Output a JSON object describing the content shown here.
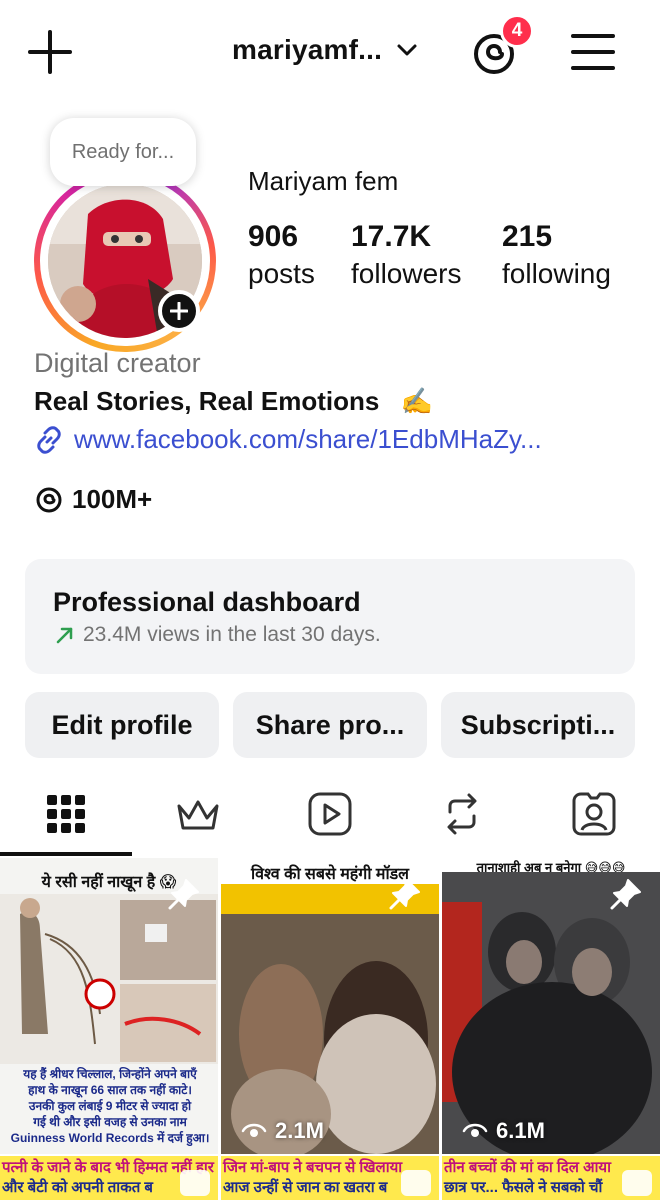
{
  "header": {
    "username": "mariyamf...",
    "notification_count": "4"
  },
  "note": {
    "text": "Ready for..."
  },
  "profile": {
    "display_name": "Mariyam fem",
    "stats": [
      {
        "value": "906",
        "label": "posts"
      },
      {
        "value": "17.7K",
        "label": "followers"
      },
      {
        "value": "215",
        "label": "following"
      }
    ],
    "category": "Digital creator",
    "bio": "Real Stories, Real Emotions",
    "bio_emoji": "✍️",
    "link": "www.facebook.com/share/1EdbMHaZy...",
    "threads_followers": "100M+"
  },
  "dashboard": {
    "title": "Professional dashboard",
    "subtitle": "23.4M views in the last 30 days."
  },
  "buttons": {
    "edit": "Edit profile",
    "share": "Share pro...",
    "subscriptions": "Subscripti..."
  },
  "tabs": [
    "grid-icon",
    "crown-icon",
    "reels-icon",
    "reposts-icon",
    "tagged-icon"
  ],
  "posts": [
    {
      "title": "ये रसी नहीं नाखून है 😱",
      "caption_lines": [
        "यह हैं श्रीधर चिल्लाल, जिन्होंने अपने बाएँ",
        "हाथ के नाखून 66 साल तक नहीं काटे।",
        "उनकी कुल लंबाई 9 मीटर से ज्यादा हो",
        "गई थी और इसी वजह से उनका नाम",
        "Guinness World Records में दर्ज हुआ।"
      ],
      "views": "",
      "strip_line1": "पत्नी के जाने के बाद भी हिम्मत नहीं हार",
      "strip_line2": "और बेटी को अपनी ताकत ब"
    },
    {
      "title": "विश्व की सबसे महंगी मॉडल",
      "caption_lines": [],
      "views": "2.1M",
      "strip_line1": "जिन मां-बाप ने बचपन से खिलाया",
      "strip_line2": "आज उन्हीं से जान का खतरा ब"
    },
    {
      "title": "तानाशाही अब न बनेगा 😅😅😅",
      "caption_lines": [],
      "views": "6.1M",
      "strip_line1": "तीन बच्चों की मां का दिल आया",
      "strip_line2": "छात्र पर... फैसले ने सबको चौं"
    }
  ],
  "colors": {
    "link": "#3b4fd0",
    "badge": "#ff2e4c",
    "trend": "#2e9e4f"
  }
}
